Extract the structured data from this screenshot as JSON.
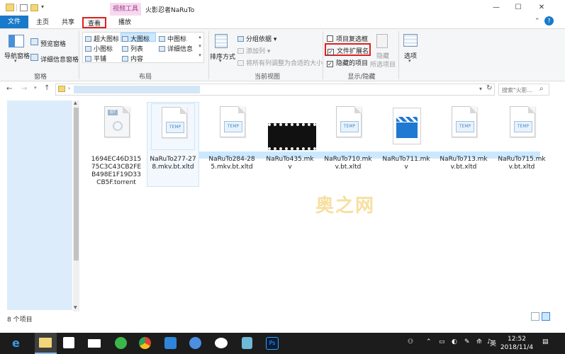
{
  "window": {
    "context_tab": "视频工具",
    "title": "火影忍者NaRuTo",
    "min_icon": "minimize-icon",
    "max_icon": "maximize-icon",
    "close_icon": "close-icon"
  },
  "tabs": {
    "file": "文件",
    "home": "主页",
    "share": "共享",
    "view": "查看",
    "play": "播放"
  },
  "ribbon": {
    "nav_pane": "导航窗格",
    "preview_pane": "预览窗格",
    "details_pane": "详细信息窗格",
    "group_pane": "窗格",
    "layout": {
      "extra_large": "超大图标",
      "large": "大图标",
      "medium": "中图标",
      "small": "小图标",
      "list": "列表",
      "details": "详细信息",
      "tiles": "平铺",
      "content": "内容"
    },
    "group_layout": "布局",
    "sort_by": "排序方式",
    "group_by": "分组依据",
    "add_column": "添加列",
    "fit_columns": "将所有列调整为合适的大小",
    "group_current_view": "当前视图",
    "item_checkboxes": "项目复选框",
    "file_extensions": "文件扩展名",
    "hidden_items": "隐藏的项目",
    "hide_label": "隐藏",
    "hide_selected": "所选项目",
    "group_show_hide": "显示/隐藏",
    "options": "选项"
  },
  "address": {
    "search_placeholder": "搜索\"火影...",
    "path": ""
  },
  "files": [
    {
      "name": "1694EC46D31575C3C43CB2FEB498E1F19D33CB5F.torrent",
      "icon": "bt-torrent-icon"
    },
    {
      "name": "NaRuTo277-278.mkv.bt.xltd",
      "icon": "temp-file-icon"
    },
    {
      "name": "NaRuTo284-285.mkv.bt.xltd",
      "icon": "temp-file-icon"
    },
    {
      "name": "NaRuTo435.mkv",
      "icon": "video-film-icon"
    },
    {
      "name": "NaRuTo710.mkv.bt.xltd",
      "icon": "temp-file-icon"
    },
    {
      "name": "NaRuTo711.mkv",
      "icon": "clapperboard-icon"
    },
    {
      "name": "NaRuTo713.mkv.bt.xltd",
      "icon": "temp-file-icon"
    },
    {
      "name": "NaRuTo715.mkv.bt.xltd",
      "icon": "temp-file-icon"
    }
  ],
  "temp_badge": "TEMP",
  "bt_badge": "BT",
  "watermark": "奥之网",
  "status": {
    "count": "8 个项目"
  },
  "taskbar": {
    "ime": "英",
    "time": "12:52",
    "date": "2018/11/4"
  },
  "colors": {
    "accent": "#1979ca",
    "highlight": "#e02020",
    "selection": "#cce8ff",
    "nav_pane": "#dcecfa"
  }
}
